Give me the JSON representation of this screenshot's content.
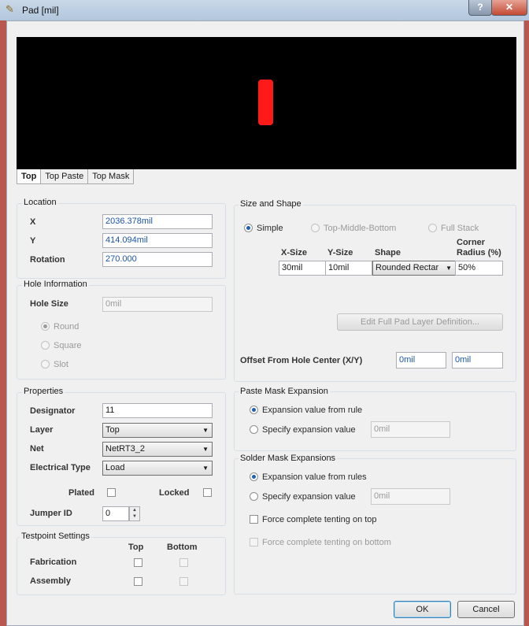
{
  "window": {
    "title": "Pad [mil]",
    "help_label": "?",
    "close_label": "✕",
    "icon": "pad-icon"
  },
  "tabs": [
    "Top",
    "Top Paste",
    "Top Mask"
  ],
  "location": {
    "title": "Location",
    "x_label": "X",
    "x_value": "2036.378mil",
    "y_label": "Y",
    "y_value": "414.094mil",
    "rotation_label": "Rotation",
    "rotation_value": "270.000"
  },
  "hole": {
    "title": "Hole Information",
    "size_label": "Hole Size",
    "size_value": "0mil",
    "round": "Round",
    "square": "Square",
    "slot": "Slot"
  },
  "properties": {
    "title": "Properties",
    "designator_label": "Designator",
    "designator_value": "11",
    "layer_label": "Layer",
    "layer_value": "Top",
    "net_label": "Net",
    "net_value": "NetRT3_2",
    "etype_label": "Electrical Type",
    "etype_value": "Load",
    "plated_label": "Plated",
    "locked_label": "Locked",
    "jumper_label": "Jumper ID",
    "jumper_value": "0"
  },
  "testpoint": {
    "title": "Testpoint Settings",
    "top": "Top",
    "bottom": "Bottom",
    "fabrication": "Fabrication",
    "assembly": "Assembly"
  },
  "size_shape": {
    "title": "Size and Shape",
    "simple": "Simple",
    "tmb": "Top-Middle-Bottom",
    "full_stack": "Full Stack",
    "col_x": "X-Size",
    "col_y": "Y-Size",
    "col_shape": "Shape",
    "col_corner": "Corner\nRadius (%)",
    "x_value": "30mil",
    "y_value": "10mil",
    "shape_value": "Rounded Rectar",
    "corner_value": "50%",
    "edit_button": "Edit Full Pad Layer Definition...",
    "offset_label": "Offset From Hole Center (X/Y)",
    "offset_x": "0mil",
    "offset_y": "0mil"
  },
  "paste": {
    "title": "Paste Mask Expansion",
    "from_rule": "Expansion value from rule",
    "specify": "Specify expansion value",
    "value": "0mil"
  },
  "solder": {
    "title": "Solder Mask Expansions",
    "from_rules": "Expansion value from rules",
    "specify": "Specify expansion value",
    "value": "0mil",
    "tent_top": "Force complete tenting on top",
    "tent_bottom": "Force complete tenting on bottom"
  },
  "buttons": {
    "ok": "OK",
    "cancel": "Cancel"
  }
}
